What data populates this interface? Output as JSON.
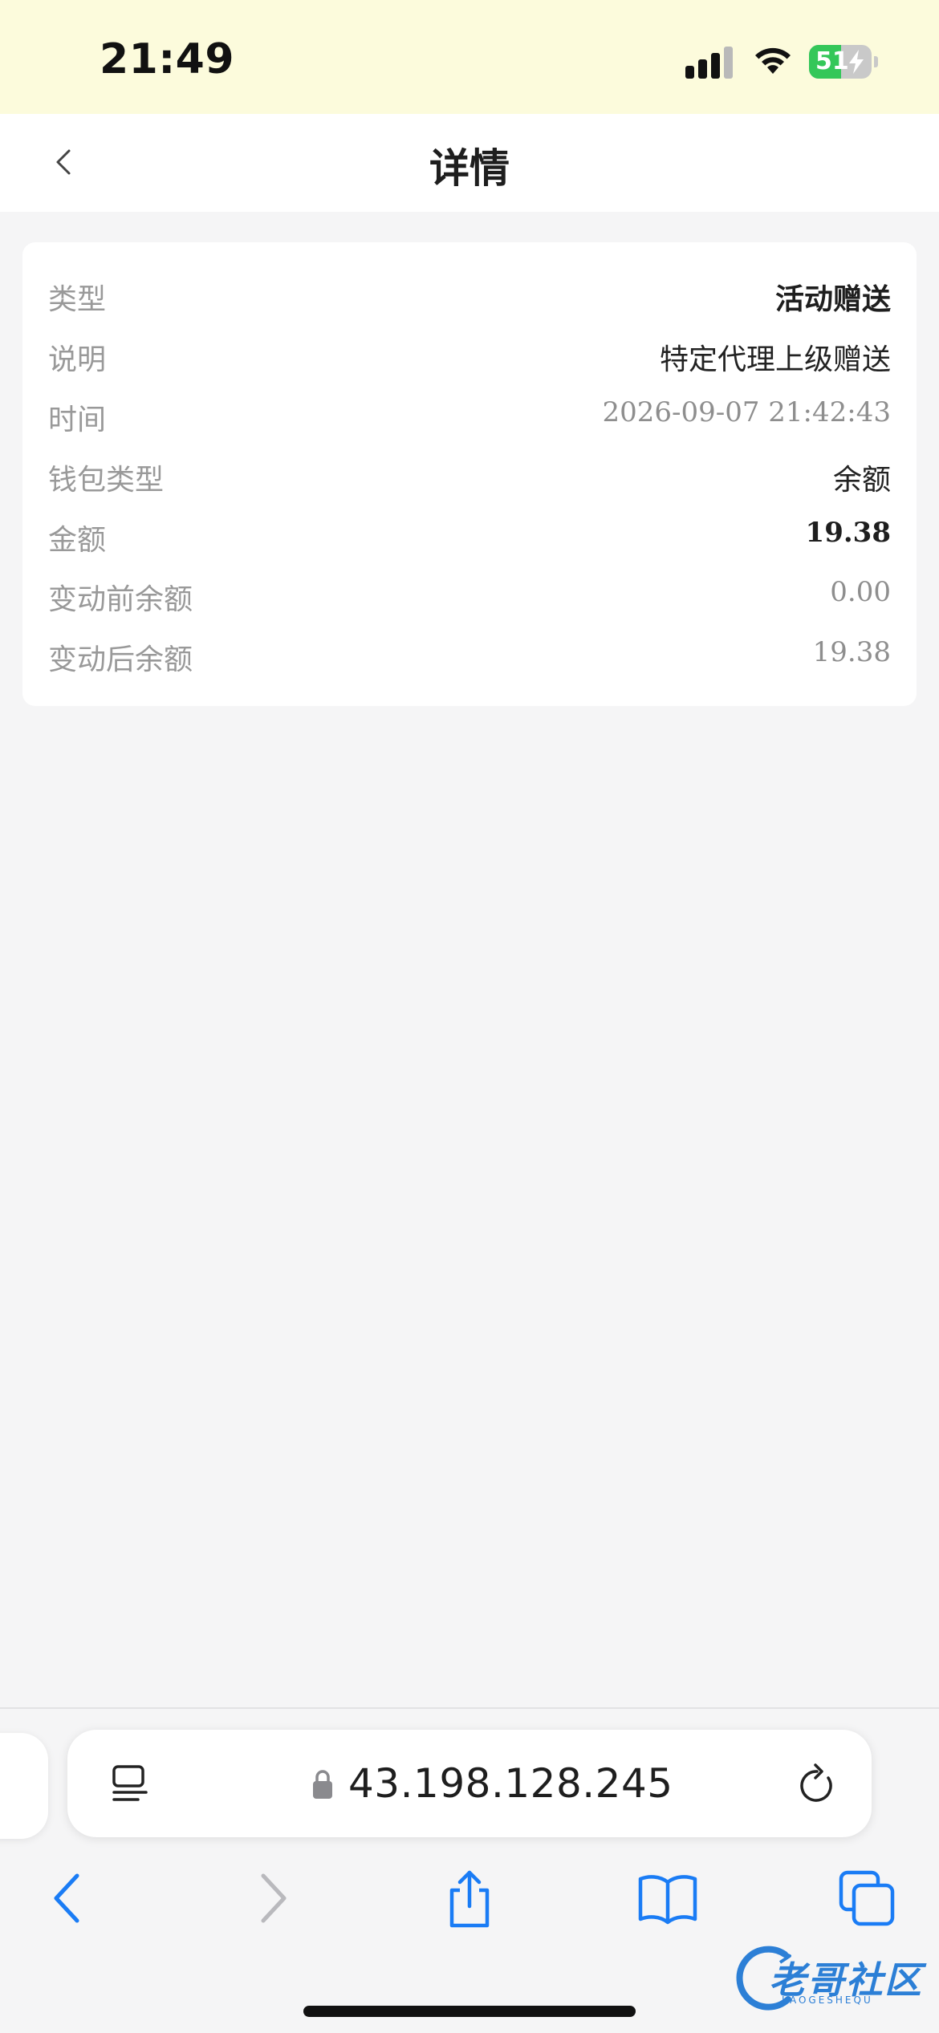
{
  "status_bar": {
    "time": "21:49",
    "battery_level": "51",
    "battery_fraction": 0.51
  },
  "nav": {
    "title": "详情"
  },
  "detail": {
    "rows": [
      {
        "label": "类型",
        "value": "活动赠送"
      },
      {
        "label": "说明",
        "value": "特定代理上级赠送"
      },
      {
        "label": "时间",
        "value": "2026-09-07 21:42:43"
      },
      {
        "label": "钱包类型",
        "value": "余额"
      },
      {
        "label": "金额",
        "value": "19.38"
      },
      {
        "label": "变动前余额",
        "value": "0.00"
      },
      {
        "label": "变动后余额",
        "value": "19.38"
      }
    ]
  },
  "browser": {
    "address": "43.198.128.245"
  },
  "watermark": {
    "text": "老哥社区",
    "sub": "LAOGESHEQU"
  },
  "colors": {
    "status_bar_bg": "#fcfbdc",
    "page_bg": "#f5f5f6",
    "safari_blue": "#1a7cf5",
    "battery_green": "#34c759"
  },
  "icons": {
    "back": "chevron-left-icon",
    "reader": "reader-mode-icon",
    "lock": "lock-icon",
    "reload": "reload-icon",
    "safari_back": "chevron-left-icon",
    "safari_forward": "chevron-right-icon",
    "share": "share-icon",
    "bookmarks": "book-icon",
    "tabs": "tabs-icon"
  }
}
